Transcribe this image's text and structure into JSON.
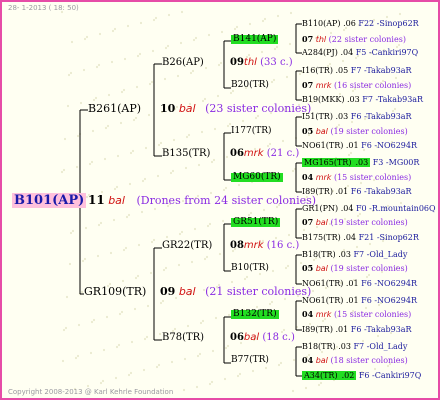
{
  "header": {
    "date": "28- 1-2013 ( 18: 50)"
  },
  "footer": {
    "copyright": "Copyright 2008-2013 @ Karl Kehrle Foundation"
  },
  "colors": {
    "frame": "#e64ca7",
    "highlight_green": "#22dd22",
    "root_bg": "#ffc0dc",
    "queen_red": "#d01010",
    "sister_purple": "#8a2be2",
    "id_blue": "#1a1a9c"
  },
  "root": {
    "id": "B101(AP)",
    "year": "11",
    "line": "bal",
    "note": "(Drones from 24 sister colonies)"
  },
  "gen1": {
    "top": {
      "id": "B261(AP)",
      "year": "10",
      "line": "bal",
      "sisters": "(23 sister colonies)"
    },
    "bottom": {
      "id": "GR109(TR)",
      "year": "09",
      "line": "bal",
      "sisters": "(21 sister colonies)"
    }
  },
  "gen2": [
    {
      "id": "B26(AP)",
      "year": "09",
      "line": "thl",
      "sisters": "(33 c.)"
    },
    {
      "id": "B135(TR)",
      "year": "06",
      "line": "mrk",
      "sisters": "(21 c.)"
    },
    {
      "id": "GR22(TR)",
      "year": "08",
      "line": "mrk",
      "sisters": "(16 c.)"
    },
    {
      "id": "B78(TR)",
      "year": "06",
      "line": "bal",
      "sisters": "(18 c.)"
    }
  ],
  "gen3": [
    {
      "id": "B141(AP)",
      "year": "07",
      "line": "thl",
      "sisters": "(22 sister colonies)"
    },
    {
      "id": "B20(TR)",
      "year": "07",
      "line": "mrk",
      "sisters": "(16 sister colonies)"
    },
    {
      "id": "I177(TR)",
      "year": "05",
      "line": "bal",
      "sisters": "(19 sister colonies)"
    },
    {
      "id": "MG60(TR)",
      "year": "04",
      "line": "mrk",
      "sisters": "(15 sister colonies)"
    },
    {
      "id": "GR51(TR)",
      "year": "07",
      "line": "bal",
      "sisters": "(19 sister colonies)"
    },
    {
      "id": "B10(TR)",
      "year": "05",
      "line": "bal",
      "sisters": "(19 sister colonies)"
    },
    {
      "id": "B132(TR)",
      "year": "04",
      "line": "mrk",
      "sisters": "(15 sister colonies)"
    },
    {
      "id": "B77(TR)",
      "year": "04",
      "line": "bal",
      "sisters": "(18 sister colonies)"
    }
  ],
  "gen4": [
    {
      "id": "B110(AP)",
      "yr": ".06",
      "origin": "F22 -Sinop62R"
    },
    {
      "id": "A284(PJ)",
      "yr": ".04",
      "origin": "F5 -Cankiri97Q"
    },
    {
      "id": "I16(TR)",
      "yr": ".05",
      "origin": "F7 -Takab93aR"
    },
    {
      "id": "B19(MKK)",
      "yr": ".03",
      "origin": "F7 -Takab93aR"
    },
    {
      "id": "I51(TR)",
      "yr": ".03",
      "origin": "F6 -Takab93aR"
    },
    {
      "id": "NO61(TR)",
      "yr": ".01",
      "origin": "F6 -NO6294R"
    },
    {
      "id": "MG165(TR)",
      "yr": ".03",
      "origin": "F3 -MG00R"
    },
    {
      "id": "I89(TR)",
      "yr": ".01",
      "origin": "F6 -Takab93aR"
    },
    {
      "id": "GR1(PN)",
      "yr": ".04",
      "origin": "F0 -R.mountain06Q"
    },
    {
      "id": "B175(TR)",
      "yr": ".04",
      "origin": "F21 -Sinop62R"
    },
    {
      "id": "B18(TR)",
      "yr": ".03",
      "origin": "F7 -Old_Lady"
    },
    {
      "id": "NO61(TR)",
      "yr": ".01",
      "origin": "F6 -NO6294R"
    },
    {
      "id": "NO61(TR)",
      "yr": ".01",
      "origin": "F6 -NO6294R"
    },
    {
      "id": "I89(TR)",
      "yr": ".01",
      "origin": "F6 -Takab93aR"
    },
    {
      "id": "B18(TR)",
      "yr": ".03",
      "origin": "F7 -Old_Lady"
    },
    {
      "id": "A34(TR)",
      "yr": ".02",
      "origin": "F6 -Cankiri97Q"
    }
  ]
}
